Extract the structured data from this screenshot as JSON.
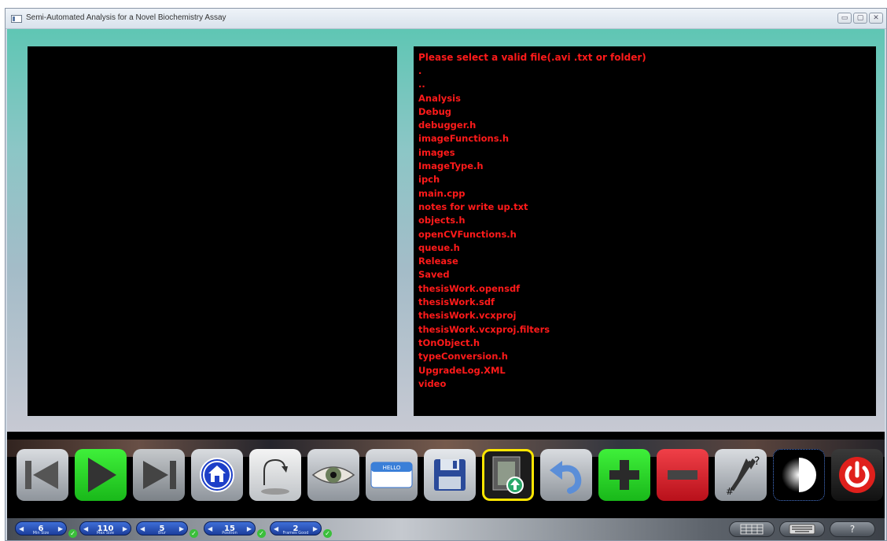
{
  "window": {
    "title": "Semi-Automated Analysis for a Novel Biochemistry Assay"
  },
  "file_browser": {
    "header": "Please select a valid file(.avi .txt or folder)",
    "items": [
      ".",
      "..",
      "Analysis",
      "Debug",
      "debugger.h",
      "imageFunctions.h",
      "images",
      "ImageType.h",
      "ipch",
      "main.cpp",
      "notes for write up.txt",
      "objects.h",
      "openCVFunctions.h",
      "queue.h",
      "Release",
      "Saved",
      "thesisWork.opensdf",
      "thesisWork.sdf",
      "thesisWork.vcxproj",
      "thesisWork.vcxproj.filters",
      "tOnObject.h",
      "typeConversion.h",
      "UpgradeLog.XML",
      "video"
    ],
    "text_color": "#ff1a1a"
  },
  "toolbar": {
    "buttons": [
      {
        "icon": "skip-back-icon"
      },
      {
        "icon": "play-icon",
        "active": true
      },
      {
        "icon": "skip-forward-icon"
      },
      {
        "icon": "home-icon"
      },
      {
        "icon": "rotate-icon"
      },
      {
        "icon": "eye-icon"
      },
      {
        "icon": "name-tag-icon"
      },
      {
        "icon": "save-icon"
      },
      {
        "icon": "load-video-icon"
      },
      {
        "icon": "undo-icon"
      },
      {
        "icon": "plus-icon"
      },
      {
        "icon": "minus-icon"
      },
      {
        "icon": "pointer-help-icon"
      },
      {
        "icon": "contrast-icon"
      },
      {
        "icon": "power-icon"
      }
    ]
  },
  "status_bar": {
    "spinners": [
      {
        "value": "6",
        "label": "Min Size"
      },
      {
        "value": "110",
        "label": "Max Size"
      },
      {
        "value": "5",
        "label": "Blur"
      },
      {
        "value": "15",
        "label": "Position"
      },
      {
        "value": "2",
        "label": "Frames Good"
      }
    ],
    "right_buttons": [
      {
        "icon": "grid-icon"
      },
      {
        "icon": "keyboard-icon"
      },
      {
        "icon": "help-icon",
        "label": "?"
      }
    ]
  }
}
